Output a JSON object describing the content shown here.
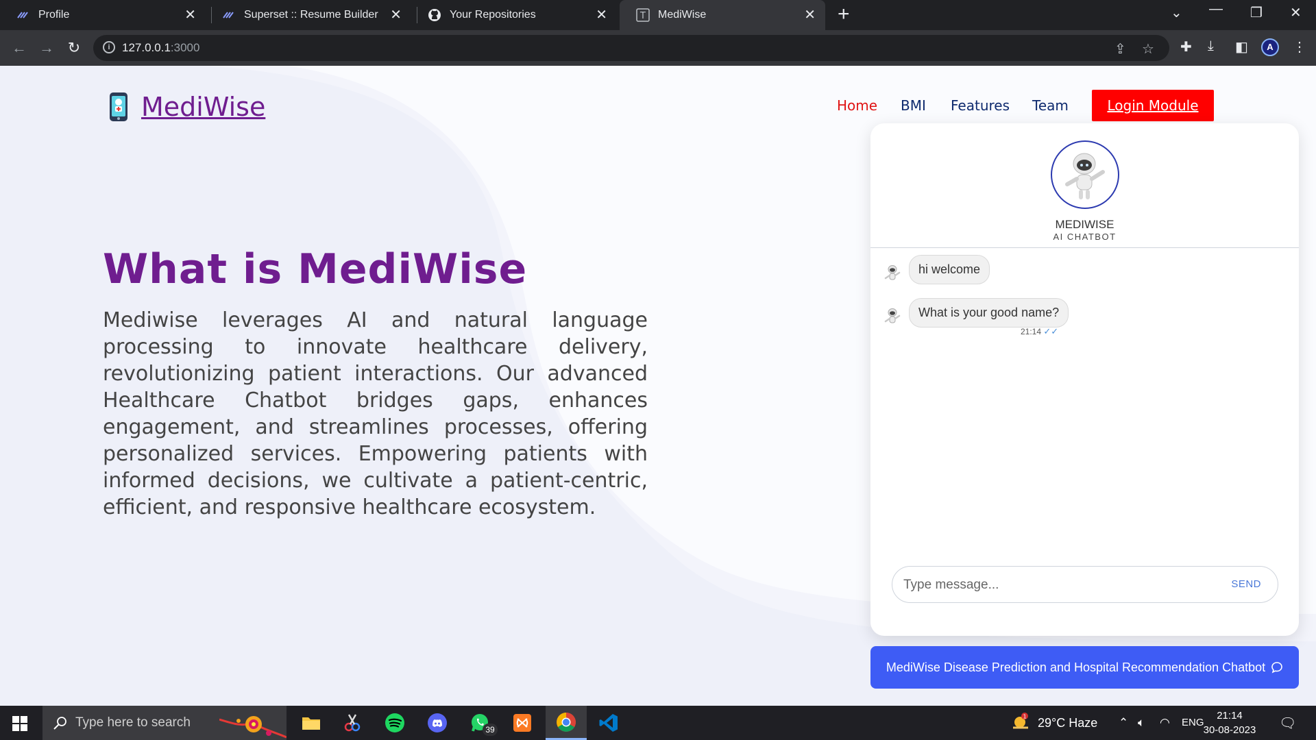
{
  "browser": {
    "tabs": [
      {
        "title": "Profile",
        "active": false
      },
      {
        "title": "Superset :: Resume Builder",
        "active": false
      },
      {
        "title": "Your Repositories",
        "active": false
      },
      {
        "title": "MediWise",
        "active": true
      }
    ],
    "url_host": "127.0.0.1",
    "url_port": ":3000",
    "profile_initial": "A"
  },
  "site": {
    "logo_text": "MediWise",
    "nav": [
      {
        "label": "Home",
        "active": true
      },
      {
        "label": "BMI",
        "active": false
      },
      {
        "label": "Features",
        "active": false
      },
      {
        "label": "Team",
        "active": false
      }
    ],
    "login_label": "Login Module"
  },
  "hero": {
    "title": "What is MediWise",
    "body": "Mediwise leverages AI and natural language processing to innovate healthcare delivery, revolutionizing patient interactions. Our advanced Healthcare Chatbot bridges gaps, enhances engagement, and streamlines processes, offering personalized services. Empowering patients with informed decisions, we cultivate a patient-centric, efficient, and responsive healthcare ecosystem."
  },
  "chat": {
    "bot_name": "MEDIWISE",
    "bot_subtitle": "AI CHATBOT",
    "messages": [
      {
        "text": "hi welcome"
      },
      {
        "text": "What is your good name?"
      }
    ],
    "last_time": "21:14",
    "input_placeholder": "Type message...",
    "send_label": "SEND",
    "toggle_label": "MediWise Disease Prediction and Hospital Recommendation Chatbot"
  },
  "taskbar": {
    "search_placeholder": "Type here to search",
    "whatsapp_badge": "39",
    "weather": "29°C  Haze",
    "weather_alert": "1",
    "lang": "ENG",
    "time": "21:14",
    "date": "30-08-2023"
  },
  "colors": {
    "brand_purple": "#6f1d8f",
    "nav_blue": "#0e2a6e",
    "login_red": "#ff0000",
    "chat_accent": "#3e5cf5"
  }
}
